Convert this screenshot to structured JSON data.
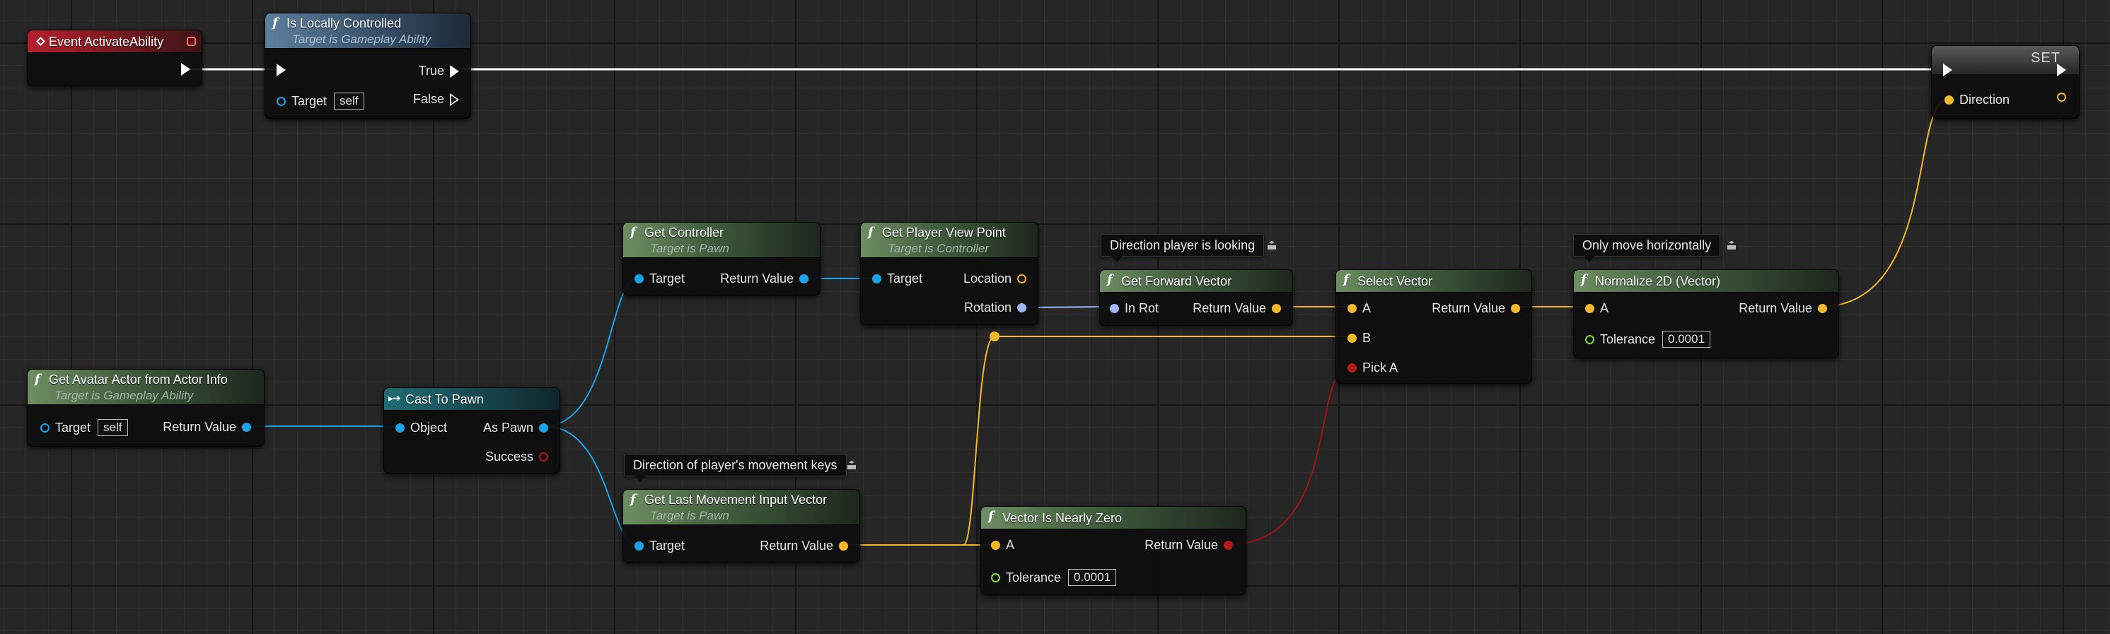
{
  "colors": {
    "exec": "#ffffff",
    "object": "#1aa3e8",
    "vector": "#f4b92b",
    "rotator": "#a1b4f5",
    "bool": "#b31b1b",
    "float": "#7ddc3e"
  },
  "nodes": {
    "event_activate": {
      "title": "Event ActivateAbility"
    },
    "is_locally_controlled": {
      "title": "Is Locally Controlled",
      "subtitle": "Target is Gameplay Ability",
      "target_label": "Target",
      "target_value": "self",
      "true_label": "True",
      "false_label": "False"
    },
    "set_direction": {
      "title": "SET",
      "var_label": "Direction"
    },
    "get_avatar": {
      "title": "Get Avatar Actor from Actor Info",
      "subtitle": "Target is Gameplay Ability",
      "target_label": "Target",
      "target_value": "self",
      "return_label": "Return Value"
    },
    "cast_to_pawn": {
      "title": "Cast To Pawn",
      "object_label": "Object",
      "as_pawn_label": "As Pawn",
      "success_label": "Success"
    },
    "get_controller": {
      "title": "Get Controller",
      "subtitle": "Target is Pawn",
      "target_label": "Target",
      "return_label": "Return Value"
    },
    "get_view_point": {
      "title": "Get Player View Point",
      "subtitle": "Target is Controller",
      "target_label": "Target",
      "location_label": "Location",
      "rotation_label": "Rotation"
    },
    "get_forward": {
      "title": "Get Forward Vector",
      "in_label": "In Rot",
      "return_label": "Return Value",
      "comment": "Direction player is looking"
    },
    "select_vector": {
      "title": "Select Vector",
      "a_label": "A",
      "b_label": "B",
      "pick_label": "Pick A",
      "return_label": "Return Value"
    },
    "normalize": {
      "title": "Normalize 2D (Vector)",
      "a_label": "A",
      "tolerance_label": "Tolerance",
      "tolerance_value": "0.0001",
      "return_label": "Return Value",
      "comment": "Only move horizontally"
    },
    "last_movement": {
      "title": "Get Last Movement Input Vector",
      "subtitle": "Target is Pawn",
      "target_label": "Target",
      "return_label": "Return Value",
      "comment": "Direction of player's movement keys"
    },
    "nearly_zero": {
      "title": "Vector Is Nearly Zero",
      "a_label": "A",
      "tolerance_label": "Tolerance",
      "tolerance_value": "0.0001",
      "return_label": "Return Value"
    }
  }
}
